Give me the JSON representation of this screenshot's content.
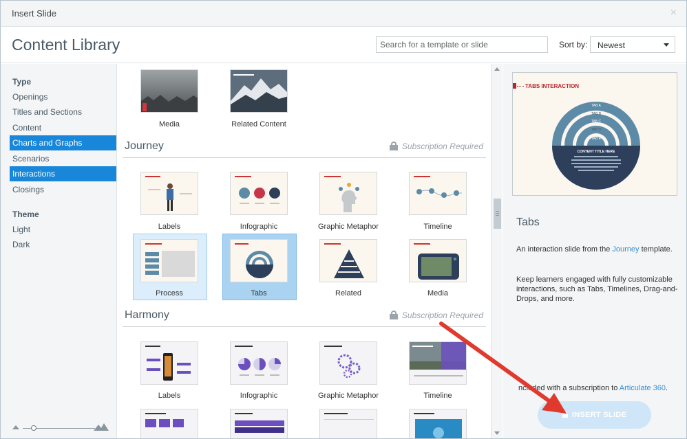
{
  "window": {
    "title": "Insert Slide",
    "close_glyph": "×"
  },
  "header": {
    "title": "Content Library",
    "search_placeholder": "Search for a template or slide",
    "sort_label": "Sort by:",
    "sort_value": "Newest"
  },
  "sidebar": {
    "type_heading": "Type",
    "type_items": [
      "Openings",
      "Titles and Sections",
      "Content",
      "Charts and Graphs",
      "Scenarios",
      "Interactions",
      "Closings"
    ],
    "theme_heading": "Theme",
    "theme_items": [
      "Light",
      "Dark"
    ]
  },
  "grid": {
    "top_row": [
      "Media",
      "Related Content"
    ],
    "journey": {
      "title": "Journey",
      "subscription": "Subscription Required",
      "row1": [
        "Labels",
        "Infographic",
        "Graphic Metaphor",
        "Timeline"
      ],
      "row2": [
        "Process",
        "Tabs",
        "Related",
        "Media"
      ]
    },
    "harmony": {
      "title": "Harmony",
      "subscription": "Subscription Required",
      "row1": [
        "Labels",
        "Infographic",
        "Graphic Metaphor",
        "Timeline"
      ]
    }
  },
  "preview": {
    "slide_heading": "TABS INTERACTION",
    "tab_labels": [
      "TAB A",
      "TAB B",
      "TAB C",
      "TAB D",
      "TAB E"
    ],
    "content_title": "CONTENT TITLE HERE",
    "name": "Tabs",
    "desc_prefix": "An interaction slide from the ",
    "desc_link": "Journey",
    "desc_suffix": " template.",
    "desc2": "Keep learners engaged with fully customizable interactions, such as Tabs, Timelines, Drag-and-Drops, and more.",
    "included_prefix": "ncluded with a subscription to ",
    "included_link": "Articulate 360",
    "included_suffix": ".",
    "insert_button": "INSERT SLIDE"
  },
  "colors": {
    "accent": "#1987d9",
    "arrow": "#e03a2f",
    "selected_strong": "#aad3f2",
    "selected_light": "#dceefb"
  }
}
